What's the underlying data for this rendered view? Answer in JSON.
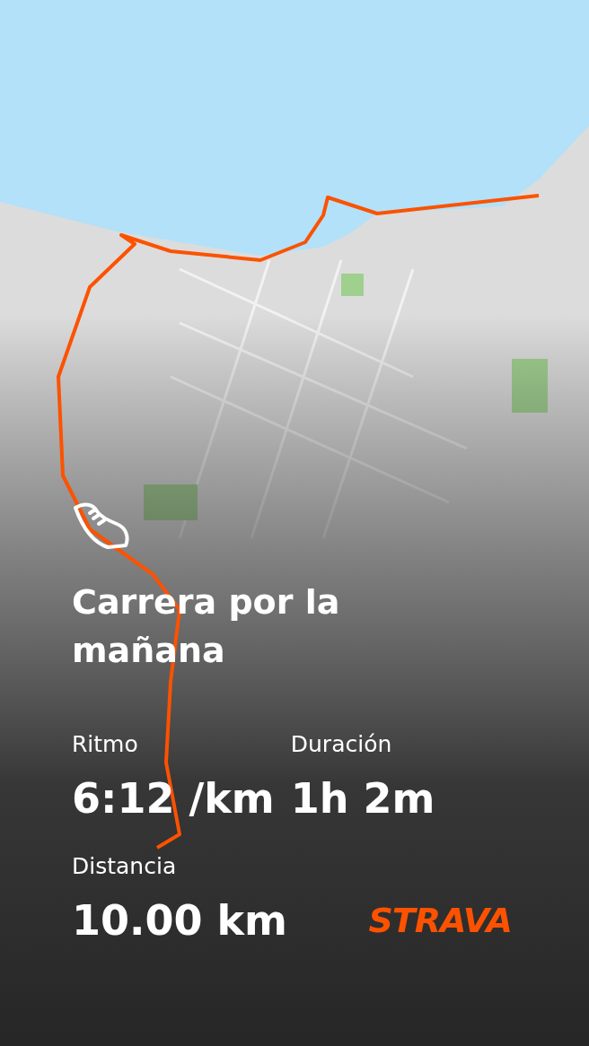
{
  "activity": {
    "title": "Carrera por la mañana"
  },
  "stats": [
    {
      "label": "Ritmo",
      "value": "6:12 /km"
    },
    {
      "label": "Duración",
      "value": "1h 2m"
    },
    {
      "label": "Distancia",
      "value": "10.00 km"
    }
  ],
  "brand": {
    "logo": "STRAVA"
  }
}
